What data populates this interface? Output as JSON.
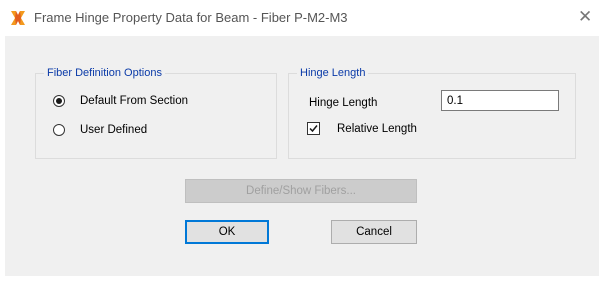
{
  "window": {
    "title": "Frame Hinge Property Data for Beam - Fiber P-M2-M3",
    "close_symbol": "✕",
    "icon": "app-x-icon"
  },
  "fiber_options": {
    "title": "Fiber Definition Options",
    "options": [
      {
        "label": "Default From Section",
        "selected": true
      },
      {
        "label": "User Defined",
        "selected": false
      }
    ]
  },
  "hinge_length": {
    "title": "Hinge Length",
    "field_label": "Hinge Length",
    "field_value": "0.1",
    "relative_label": "Relative Length",
    "relative_checked": true
  },
  "buttons": {
    "define_fibers": "Define/Show Fibers...",
    "ok": "OK",
    "cancel": "Cancel"
  },
  "colors": {
    "group_title": "#0a3aa8",
    "icon_orange": "#f39a1e",
    "icon_red": "#d62b1f"
  }
}
